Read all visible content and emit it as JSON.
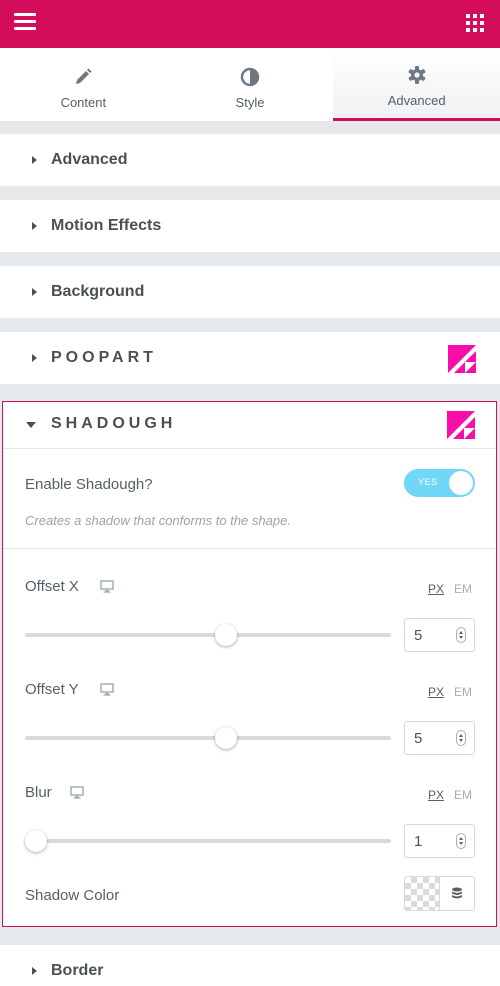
{
  "colors": {
    "brand": "#d30c5c",
    "toggle_on": "#71d7f7",
    "text": "#495157"
  },
  "topbar": {
    "menu_icon": "hamburger-menu-icon",
    "widgets_icon": "grid-apps-icon"
  },
  "tabs": [
    {
      "label": "Content",
      "icon": "pencil-icon",
      "active": false
    },
    {
      "label": "Style",
      "icon": "half-circle-icon",
      "active": false
    },
    {
      "label": "Advanced",
      "icon": "gear-icon",
      "active": true
    }
  ],
  "sections": {
    "advanced": {
      "title": "Advanced"
    },
    "motion": {
      "title": "Motion Effects"
    },
    "background": {
      "title": "Background"
    },
    "poopart": {
      "title": "POOPART"
    },
    "shadough": {
      "title": "SHADOUGH"
    },
    "border": {
      "title": "Border"
    }
  },
  "shadough": {
    "enable_label": "Enable Shadough?",
    "toggle_label": "YES",
    "toggle_on": true,
    "hint": "Creates a shadow that conforms to the shape.",
    "offset_x": {
      "label": "Offset X",
      "value": "5",
      "unit_px": "PX",
      "unit_em": "EM",
      "fraction": 0.55
    },
    "offset_y": {
      "label": "Offset Y",
      "value": "5",
      "unit_px": "PX",
      "unit_em": "EM",
      "fraction": 0.55
    },
    "blur": {
      "label": "Blur",
      "value": "1",
      "unit_px": "PX",
      "unit_em": "EM",
      "fraction": 0.0
    },
    "shadow_color_label": "Shadow Color"
  }
}
